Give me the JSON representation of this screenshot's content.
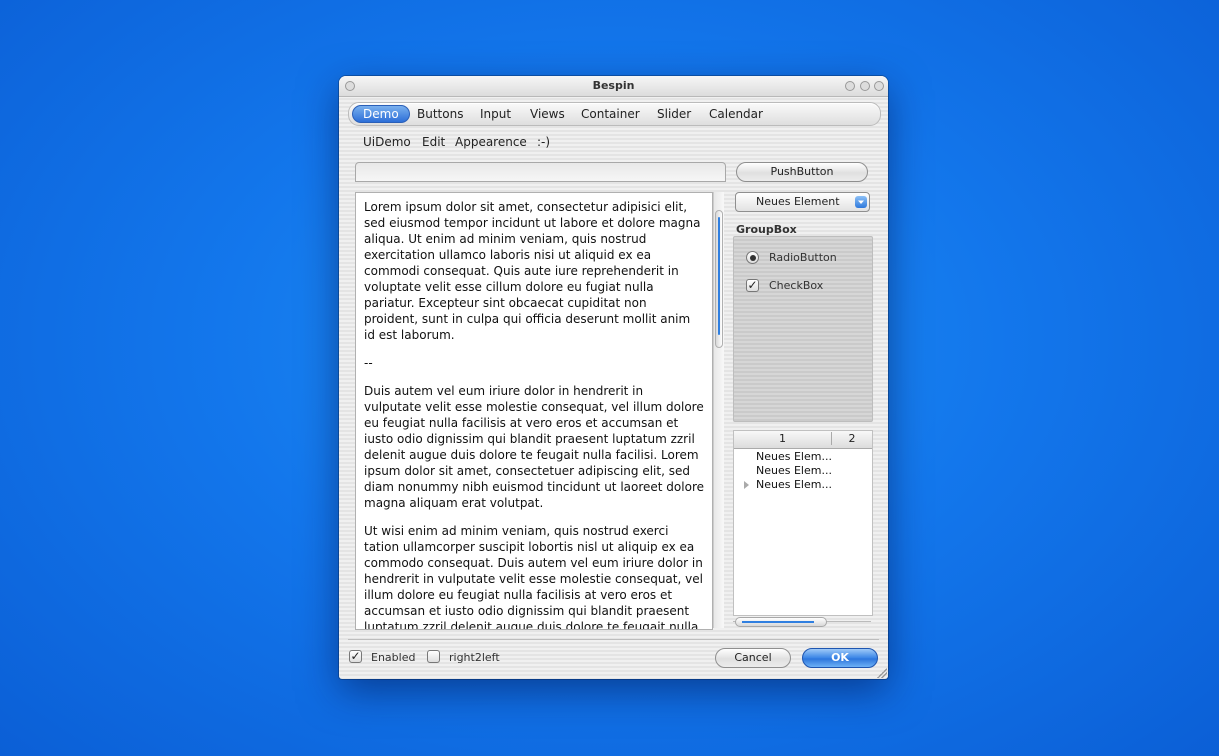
{
  "window": {
    "title": "Bespin"
  },
  "tabs": [
    "Demo",
    "Buttons",
    "Input",
    "Views",
    "Container",
    "Slider",
    "Calendar"
  ],
  "menu": [
    "UiDemo",
    "Edit",
    "Appearence",
    ":-)"
  ],
  "lineedit": {
    "value": ""
  },
  "pushbutton": {
    "label": "PushButton"
  },
  "combobox": {
    "selected": "Neues Element"
  },
  "text": {
    "p1": "Lorem ipsum dolor sit amet, consectetur adipisici elit, sed eiusmod tempor incidunt ut labore et dolore magna aliqua. Ut enim ad minim veniam, quis nostrud exercitation ullamco laboris nisi ut aliquid ex ea commodi consequat. Quis aute iure reprehenderit in voluptate velit esse cillum dolore eu fugiat nulla pariatur. Excepteur sint obcaecat cupiditat non proident, sunt in culpa qui officia deserunt mollit anim id est laborum.",
    "p2": "--",
    "p3": "Duis autem vel eum iriure dolor in hendrerit in vulputate velit esse molestie consequat, vel illum dolore eu feugiat nulla facilisis at vero eros et accumsan et iusto odio dignissim qui blandit praesent luptatum zzril delenit augue duis dolore te feugait nulla facilisi. Lorem ipsum dolor sit amet, consectetuer adipiscing elit, sed diam nonummy nibh euismod tincidunt ut laoreet dolore magna aliquam erat volutpat.",
    "p4": "Ut wisi enim ad minim veniam, quis nostrud exerci tation ullamcorper suscipit lobortis nisl ut aliquip ex ea commodo consequat. Duis autem vel eum iriure dolor in hendrerit in vulputate velit esse molestie consequat, vel illum dolore eu feugiat nulla facilisis at vero eros et accumsan et iusto odio dignissim qui blandit praesent luptatum zzril delenit augue duis dolore te feugait nulla facilisi."
  },
  "groupbox": {
    "title": "GroupBox",
    "radio": {
      "label": "RadioButton",
      "checked": true
    },
    "checkbox": {
      "label": "CheckBox",
      "checked": true
    }
  },
  "tree": {
    "headers": [
      "1",
      "2"
    ],
    "rows": [
      "Neues Elem...",
      "Neues Elem...",
      "Neues Elem..."
    ]
  },
  "footer": {
    "enabled": {
      "label": "Enabled",
      "checked": true
    },
    "right2left": {
      "label": "right2left",
      "checked": false
    },
    "cancel_label": "Cancel",
    "ok_label": "OK"
  },
  "colors": {
    "accent": "#2d6fd8",
    "desktop": "#1377ec"
  }
}
